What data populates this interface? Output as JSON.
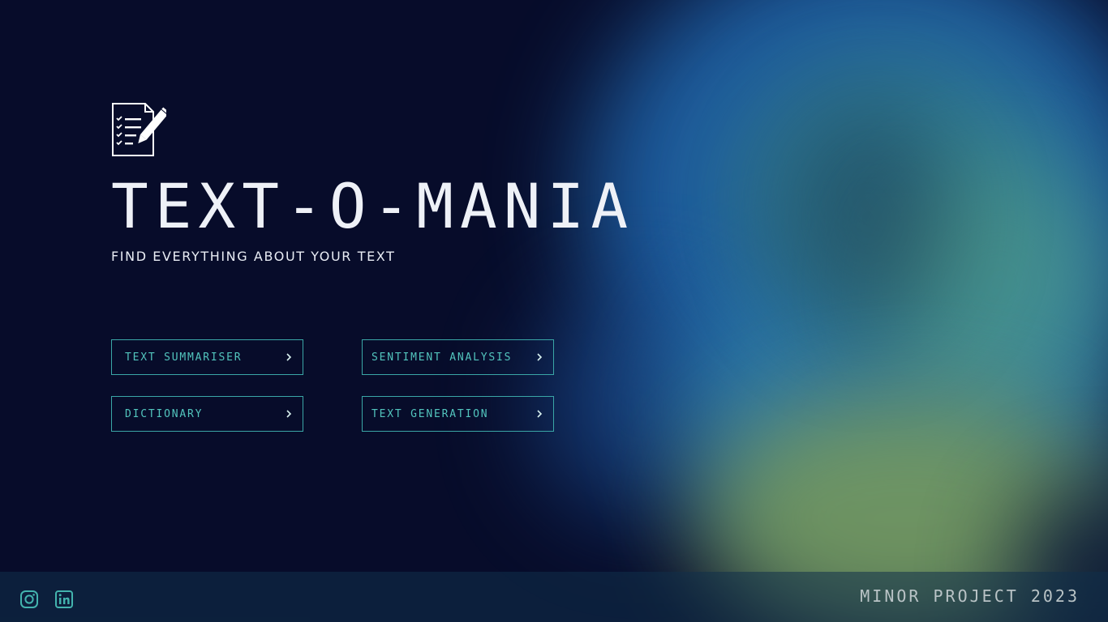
{
  "app": {
    "title": "TEXT-O-MANIA",
    "subtitle": "FIND EVERYTHING ABOUT YOUR TEXT",
    "logo_icon": "document-pen-icon"
  },
  "buttons": [
    {
      "label": "TEXT SUMMARISER",
      "icon": "chevron-right-icon"
    },
    {
      "label": "SENTIMENT ANALYSIS",
      "icon": "chevron-right-icon"
    },
    {
      "label": "DICTIONARY",
      "icon": "chevron-right-icon"
    },
    {
      "label": "TEXT GENERATION",
      "icon": "chevron-right-icon"
    }
  ],
  "footer": {
    "social": [
      {
        "icon": "instagram-icon"
      },
      {
        "icon": "linkedin-icon"
      }
    ],
    "project_label": "MINOR PROJECT 2023"
  },
  "colors": {
    "background": "#070c2a",
    "accent": "#52c4bd",
    "button_border": "#3aa6a6",
    "text": "#eef1f7"
  }
}
